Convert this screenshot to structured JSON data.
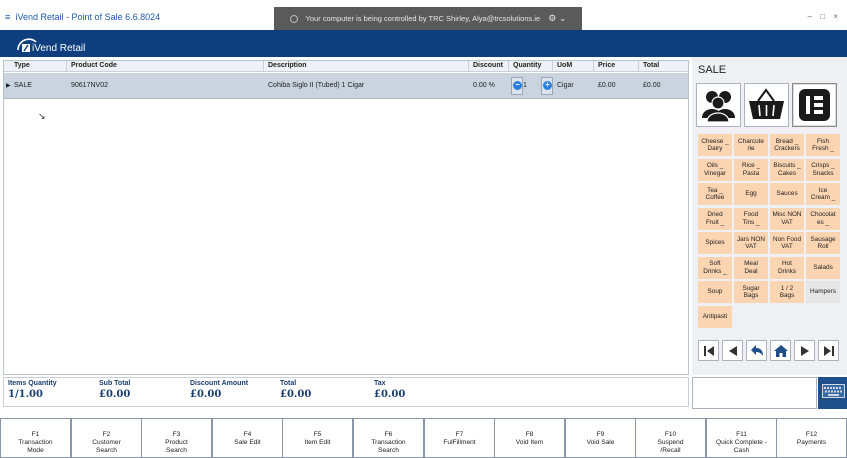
{
  "window": {
    "title": "iVend Retail - Point of Sale 6.6.8024",
    "remote_banner": "Your computer is being controlled by TRC Shirley, Alya@trcsolutions.ie",
    "controls": "– □ ×"
  },
  "header": {
    "logo_text": "iVend Retail"
  },
  "grid": {
    "columns": [
      "Type",
      "Product Code",
      "Description",
      "Discount",
      "Quantity",
      "UoM",
      "Price",
      "Total"
    ],
    "rows": [
      {
        "type": "SALE",
        "product_code": "90617NV02",
        "description": "Cohiba Siglo II (Tubed) 1 Cigar",
        "discount": "0.00 %",
        "quantity": "1",
        "uom": "Cigar",
        "price": "£0.00",
        "total": "£0.00"
      }
    ]
  },
  "totals": {
    "items_quantity": {
      "label": "Items Quantity",
      "value": "1/1.00"
    },
    "sub_total": {
      "label": "Sub Total",
      "value": "£0.00"
    },
    "discount_amount": {
      "label": "Discount Amount",
      "value": "£0.00"
    },
    "total": {
      "label": "Total",
      "value": "£0.00"
    },
    "tax": {
      "label": "Tax",
      "value": "£0.00"
    }
  },
  "side": {
    "title": "SALE",
    "big_buttons": [
      "customers-icon",
      "basket-icon",
      "receipt-icon"
    ],
    "categories": [
      "Cheese _\nDairy",
      "Charcute\nrie",
      "Bread _\nCrackers",
      "Fish\nFresh _",
      "Oils _\nVinegar",
      "Rice _\nPasta",
      "Biscuits _\nCakes",
      "Crisps _\nSnacks",
      "Tea _\nCoffee",
      "Egg",
      "Sauces",
      "Ice\nCream _",
      "Dried\nFruit _",
      "Food\nTins _",
      "Misc NON\nVAT",
      "Chocolat\nes _",
      "Spices",
      "Jars NON\nVAT",
      "Non Food\nVAT",
      "Sausage\nRoll",
      "Soft\nDrinks _",
      "Meal\nDeal",
      "Hot\nDrinks",
      "Salads",
      "Soup",
      "Sugar\nBags",
      "1 / 2\nBags",
      "Hampers",
      "Antipasti"
    ],
    "nav": [
      "first-icon",
      "prev-icon",
      "back-icon",
      "home-icon",
      "next-icon",
      "last-icon"
    ]
  },
  "fkeys": [
    {
      "code": "F1",
      "label": "Transaction\nMode"
    },
    {
      "code": "F2",
      "label": "Customer\nSearch"
    },
    {
      "code": "F3",
      "label": "Product\nSearch"
    },
    {
      "code": "F4",
      "label": "Sale Edit"
    },
    {
      "code": "F5",
      "label": "Item Edit"
    },
    {
      "code": "F6",
      "label": "Transaction\nSearch"
    },
    {
      "code": "F7",
      "label": "FulFillment"
    },
    {
      "code": "F8",
      "label": "Void Item"
    },
    {
      "code": "F9",
      "label": "Void Sale"
    },
    {
      "code": "F10",
      "label": "Suspend\n/Recall"
    },
    {
      "code": "F11",
      "label": "Quick Complete -\nCash"
    },
    {
      "code": "F12",
      "label": "Payments"
    }
  ],
  "colors": {
    "header": "#0e3e7d",
    "category_tile": "#fbd4b2",
    "row_selected": "#c9d4e0",
    "accent": "#2a7de1"
  }
}
